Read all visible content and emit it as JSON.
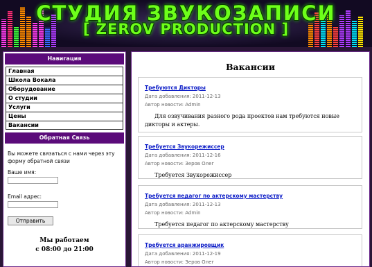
{
  "header": {
    "title_line1": "СТУДИЯ ЗВУКОЗАПИСИ",
    "title_line2": "[ ZEROV PRODUCTION ]"
  },
  "sidebar": {
    "nav_heading": "Навигация",
    "nav_items": [
      {
        "label": "Главная"
      },
      {
        "label": "Школа Вокала"
      },
      {
        "label": "Оборудование"
      },
      {
        "label": "О студии"
      },
      {
        "label": "Услуги"
      },
      {
        "label": "Цены"
      },
      {
        "label": "Вакансии"
      }
    ],
    "feedback_heading": "Обратная Связь",
    "feedback_text": "Вы можете связаться с нами через эту форму обратной связи",
    "name_label": "Ваше имя:",
    "name_value": "",
    "email_label": "Email адрес:",
    "email_value": "",
    "send_label": "Отправить",
    "hours_line1": "Мы работаем",
    "hours_line2": "с 08:00 до 21:00"
  },
  "main": {
    "title": "Вакансии",
    "posts": [
      {
        "title": "Требуются Дикторы",
        "date": "Дата добавления: 2011-12-13",
        "author": "Автор новости: Admin",
        "text": "Для озвучивания разного рода проектов нам требуются новые дикторы и актеры."
      },
      {
        "title": "Требуется Звукорежиссер",
        "date": "Дата добавления: 2011-12-16",
        "author": "Автор новости: Зеров Олег",
        "text": "Требуется Звукорежиссер"
      },
      {
        "title": "Требуется педагог по актерскому мастерству",
        "date": "Дата добавления: 2011-12-13",
        "author": "Автор новости: Admin",
        "text": "Требуется педагог по актерскому мастерству"
      },
      {
        "title": "Требуется аранжировщик",
        "date": "Дата добавления: 2011-12-19",
        "author": "Автор новости: Зеров Олег",
        "text": ""
      }
    ]
  },
  "colors": {
    "accent_purple": "#5b0b7a",
    "title_green": "#6dff1a",
    "link_blue": "#1020c8"
  }
}
